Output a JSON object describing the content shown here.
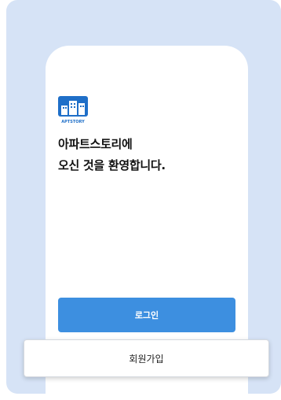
{
  "logo": {
    "icon": "apartment-building-logo",
    "text": "APTSTORY"
  },
  "welcome": {
    "line1": "아파트스토리에",
    "line2": "오신 것을 환영합니다."
  },
  "buttons": {
    "login_label": "로그인",
    "signup_label": "회원가입"
  },
  "colors": {
    "background": "#d6e3f6",
    "primary": "#3d8fe0",
    "logo": "#1f6fc8"
  }
}
